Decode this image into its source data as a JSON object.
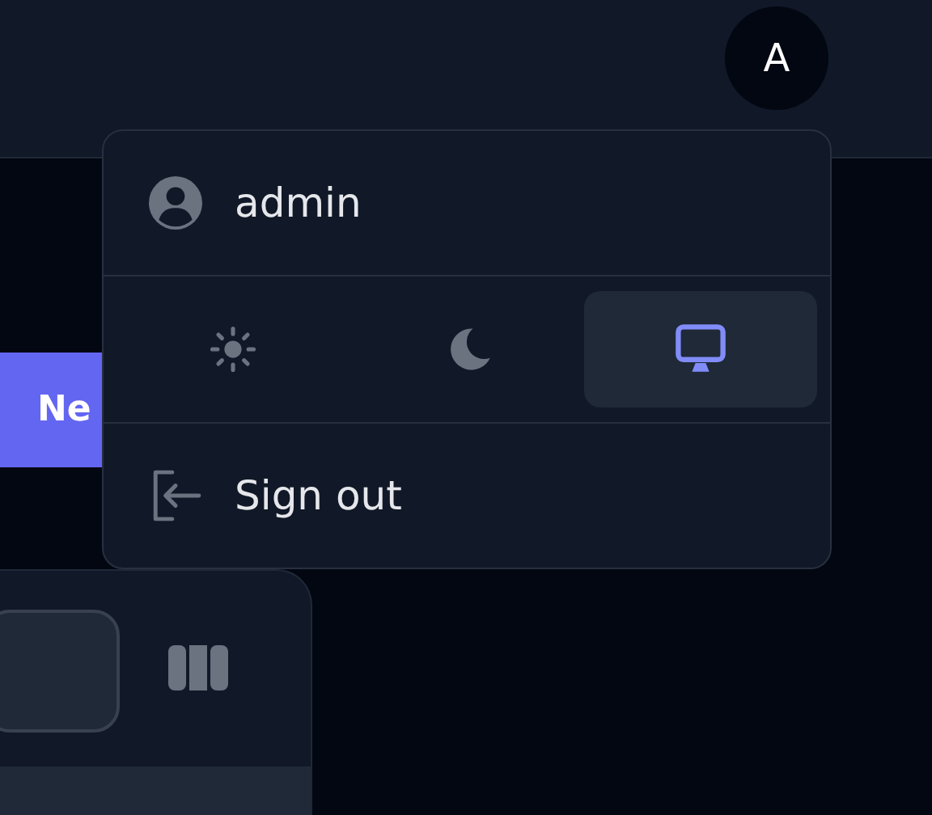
{
  "header": {
    "avatar": "A"
  },
  "new_button": {
    "label": "Ne"
  },
  "user_menu": {
    "username": "admin",
    "theme_options": [
      {
        "kind": "light",
        "selected": false
      },
      {
        "kind": "dark",
        "selected": false
      },
      {
        "kind": "system",
        "selected": true
      }
    ],
    "sign_out": "Sign out"
  }
}
